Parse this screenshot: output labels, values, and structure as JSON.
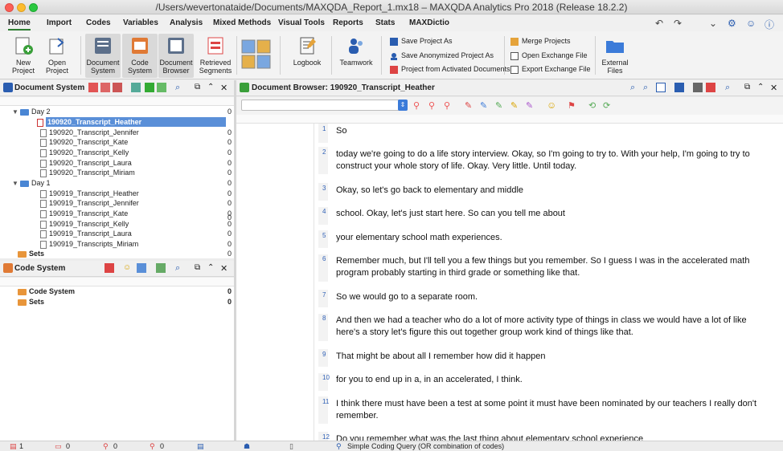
{
  "window": {
    "title": "/Users/wevertonataide/Documents/MAXQDA_Report_1.mx18 – MAXQDA Analytics Pro 2018 (Release 18.2.2)"
  },
  "menu": {
    "tabs": [
      "Home",
      "Import",
      "Codes",
      "Variables",
      "Analysis",
      "Mixed Methods",
      "Visual Tools",
      "Reports",
      "Stats",
      "MAXDictio"
    ]
  },
  "ribbon": {
    "new_project": "New\nProject",
    "open_project": "Open\nProject",
    "document_system": "Document\nSystem",
    "code_system": "Code\nSystem",
    "document_browser": "Document\nBrowser",
    "retrieved_segments": "Retrieved\nSegments",
    "logbook": "Logbook",
    "teamwork": "Teamwork",
    "save_project_as": "Save Project As",
    "save_anonymized": "Save Anonymized Project As",
    "project_from_activated": "Project from Activated Documents",
    "merge_projects": "Merge Projects",
    "open_exchange": "Open Exchange File",
    "export_exchange": "Export Exchange File",
    "external_files": "External\nFiles"
  },
  "document_system": {
    "title": "Document System",
    "groups": [
      {
        "name": "Day 2",
        "count": "0",
        "docs": [
          {
            "name": "190920_Transcript_Heather",
            "count": "0",
            "selected": true
          },
          {
            "name": "190920_Transcript_Jennifer",
            "count": "0"
          },
          {
            "name": "190920_Transcript_Kate",
            "count": "0"
          },
          {
            "name": "190920_Transcript_Kelly",
            "count": "0"
          },
          {
            "name": "190920_Transcript_Laura",
            "count": "0"
          },
          {
            "name": "190920_Transcript_Miriam",
            "count": "0"
          }
        ]
      },
      {
        "name": "Day 1",
        "count": "0",
        "docs": [
          {
            "name": "190919_Transcript_Heather",
            "count": "0"
          },
          {
            "name": "190919_Transcript_Jennifer",
            "count": "0"
          },
          {
            "name": "190919_Transcript_Kate",
            "count": "0"
          },
          {
            "name": "190919_Transcript_Kelly",
            "count": "0"
          },
          {
            "name": "190919_Transcript_Laura",
            "count": "0"
          },
          {
            "name": "190919_Transcripts_Miriam",
            "count": "0"
          }
        ]
      }
    ],
    "sets": {
      "name": "Sets",
      "count": "0"
    }
  },
  "code_system": {
    "title": "Code System",
    "items": [
      {
        "name": "Code System",
        "count": "0"
      },
      {
        "name": "Sets",
        "count": "0"
      }
    ]
  },
  "document_browser": {
    "title": "Document Browser: 190920_Transcript_Heather",
    "paragraphs": [
      {
        "num": "1",
        "text": "So"
      },
      {
        "num": "2",
        "text": "today we're going to do a life story interview. Okay, so I'm going to try to. With your help, I'm going to try to construct your whole story of life. Okay. Very little. Until today."
      },
      {
        "num": "3",
        "text": "Okay, so let's go back to elementary and middle"
      },
      {
        "num": "4",
        "text": "school. Okay, let's just start here. So can you tell me about"
      },
      {
        "num": "5",
        "text": "your elementary school math experiences."
      },
      {
        "num": "6",
        "text": "Remember much, but I'll tell you a few things but you remember. So I guess I was in the accelerated math program probably starting in third grade or something like that."
      },
      {
        "num": "7",
        "text": "So we would go to a separate room."
      },
      {
        "num": "8",
        "text": "And then we had a teacher who do a lot of more activity type of things in class we would have a lot of like here's a story let's figure this out together group work kind of things like that."
      },
      {
        "num": "9",
        "text": "That might be about all I remember how did it happen"
      },
      {
        "num": "10",
        "text": "for you to end up in a, in an accelerated, I think."
      },
      {
        "num": "11",
        "text": "I think there must have been a test at some point it must have been nominated by our teachers I really don't remember."
      },
      {
        "num": "12",
        "text": "Do you remember what was the last thing about elementary school experience"
      }
    ]
  },
  "status": {
    "docs": "1",
    "segments": "0",
    "codes": "0",
    "memos": "0",
    "query": "Simple Coding Query (OR combination of codes)"
  },
  "colors": {
    "accent": "#2e7d32",
    "selection": "#5a8fd8",
    "para_number": "#2e5fb5"
  }
}
